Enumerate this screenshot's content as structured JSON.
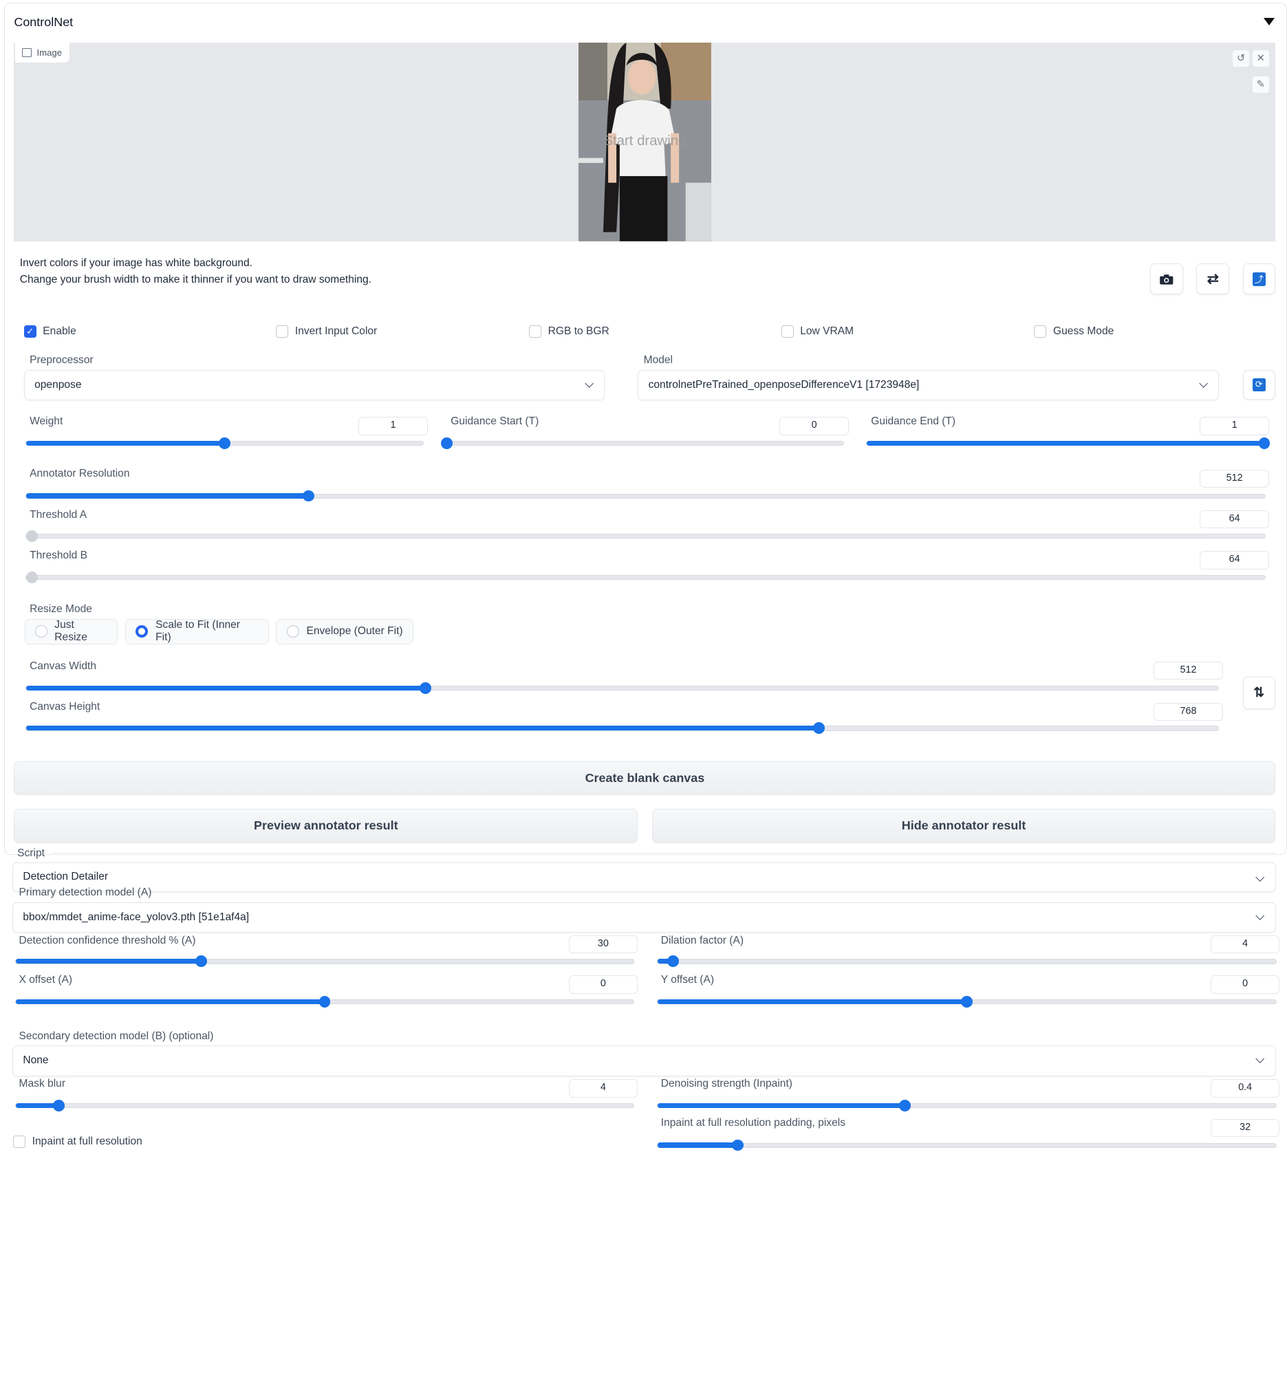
{
  "controlnet": {
    "title": "ControlNet",
    "image_label": "Image",
    "canvas_overlay": "Start drawing",
    "hint_line1": "Invert colors if your image has white background.",
    "hint_line2": "Change your brush width to make it thinner if you want to draw something.",
    "checkboxes": {
      "enable": {
        "label": "Enable",
        "checked": true
      },
      "invert": {
        "label": "Invert Input Color",
        "checked": false
      },
      "rgb_bgr": {
        "label": "RGB to BGR",
        "checked": false
      },
      "low_vram": {
        "label": "Low VRAM",
        "checked": false
      },
      "guess": {
        "label": "Guess Mode",
        "checked": false
      }
    },
    "preprocessor": {
      "label": "Preprocessor",
      "value": "openpose"
    },
    "model": {
      "label": "Model",
      "value": "controlnetPreTrained_openposeDifferenceV1 [1723948e]"
    },
    "weight": {
      "label": "Weight",
      "value": "1"
    },
    "guidance_start": {
      "label": "Guidance Start (T)",
      "value": "0"
    },
    "guidance_end": {
      "label": "Guidance End (T)",
      "value": "1"
    },
    "annotator_resolution": {
      "label": "Annotator Resolution",
      "value": "512"
    },
    "threshold_a": {
      "label": "Threshold A",
      "value": "64"
    },
    "threshold_b": {
      "label": "Threshold B",
      "value": "64"
    },
    "resize_mode": {
      "label": "Resize Mode",
      "options": [
        "Just Resize",
        "Scale to Fit (Inner Fit)",
        "Envelope (Outer Fit)"
      ],
      "selected": "Scale to Fit (Inner Fit)"
    },
    "canvas_width": {
      "label": "Canvas Width",
      "value": "512"
    },
    "canvas_height": {
      "label": "Canvas Height",
      "value": "768"
    },
    "create_blank_canvas": "Create blank canvas",
    "preview_annotator": "Preview annotator result",
    "hide_annotator": "Hide annotator result"
  },
  "script": {
    "label": "Script",
    "value": "Detection Detailer",
    "primary_model": {
      "label": "Primary detection model (A)",
      "value": "bbox/mmdet_anime-face_yolov3.pth [51e1af4a]"
    },
    "conf_threshold": {
      "label": "Detection confidence threshold % (A)",
      "value": "30"
    },
    "dilation": {
      "label": "Dilation factor (A)",
      "value": "4"
    },
    "x_offset": {
      "label": "X offset (A)",
      "value": "0"
    },
    "y_offset": {
      "label": "Y offset (A)",
      "value": "0"
    },
    "secondary_model": {
      "label": "Secondary detection model (B) (optional)",
      "value": "None"
    },
    "mask_blur": {
      "label": "Mask blur",
      "value": "4"
    },
    "denoising": {
      "label": "Denoising strength (Inpaint)",
      "value": "0.4"
    },
    "inpaint_padding": {
      "label": "Inpaint at full resolution padding, pixels",
      "value": "32"
    },
    "inpaint_full_res": {
      "label": "Inpaint at full resolution",
      "checked": false
    }
  },
  "slider_levels": {
    "weight": 0.5,
    "guidance_start": 0.0,
    "guidance_end": 1.0,
    "annotator_resolution": 0.228,
    "threshold_a": 0.0,
    "threshold_b": 0.0,
    "canvas_width": 0.335,
    "canvas_height": 0.665,
    "conf_threshold": 0.3,
    "dilation": 0.025,
    "x_offset": 0.5,
    "y_offset": 0.5,
    "mask_blur": 0.07,
    "denoising": 0.4,
    "inpaint_padding": 0.13
  },
  "colors": {
    "accent": "#1a73e8",
    "panel_border": "#e5e7eb",
    "image_bg": "#e5e7eb"
  }
}
